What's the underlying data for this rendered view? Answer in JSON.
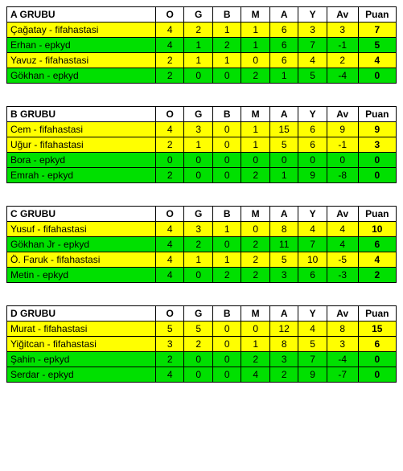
{
  "headers": {
    "o": "O",
    "g": "G",
    "b": "B",
    "m": "M",
    "a": "A",
    "y": "Y",
    "av": "Av",
    "puan": "Puan"
  },
  "groups": [
    {
      "title": "A GRUBU",
      "rows": [
        {
          "name": "Çağatay - fifahastasi",
          "cls": "yellow",
          "o": 4,
          "g": 2,
          "b": 1,
          "m": 1,
          "a": 6,
          "y": 3,
          "av": 3,
          "pts": 7
        },
        {
          "name": "Erhan - epkyd",
          "cls": "green",
          "o": 4,
          "g": 1,
          "b": 2,
          "m": 1,
          "a": 6,
          "y": 7,
          "av": -1,
          "pts": 5
        },
        {
          "name": "Yavuz - fifahastasi",
          "cls": "yellow",
          "o": 2,
          "g": 1,
          "b": 1,
          "m": 0,
          "a": 6,
          "y": 4,
          "av": 2,
          "pts": 4
        },
        {
          "name": "Gökhan - epkyd",
          "cls": "green",
          "o": 2,
          "g": 0,
          "b": 0,
          "m": 2,
          "a": 1,
          "y": 5,
          "av": -4,
          "pts": 0
        }
      ]
    },
    {
      "title": "B GRUBU",
      "rows": [
        {
          "name": "Cem - fifahastasi",
          "cls": "yellow",
          "o": 4,
          "g": 3,
          "b": 0,
          "m": 1,
          "a": 15,
          "y": 6,
          "av": 9,
          "pts": 9
        },
        {
          "name": "Uğur - fifahastasi",
          "cls": "yellow",
          "o": 2,
          "g": 1,
          "b": 0,
          "m": 1,
          "a": 5,
          "y": 6,
          "av": -1,
          "pts": 3
        },
        {
          "name": "Bora - epkyd",
          "cls": "green",
          "o": 0,
          "g": 0,
          "b": 0,
          "m": 0,
          "a": 0,
          "y": 0,
          "av": 0,
          "pts": 0
        },
        {
          "name": "Emrah - epkyd",
          "cls": "green",
          "o": 2,
          "g": 0,
          "b": 0,
          "m": 2,
          "a": 1,
          "y": 9,
          "av": -8,
          "pts": 0
        }
      ]
    },
    {
      "title": "C GRUBU",
      "rows": [
        {
          "name": "Yusuf - fifahastasi",
          "cls": "yellow",
          "o": 4,
          "g": 3,
          "b": 1,
          "m": 0,
          "a": 8,
          "y": 4,
          "av": 4,
          "pts": 10
        },
        {
          "name": "Gökhan Jr - epkyd",
          "cls": "green",
          "o": 4,
          "g": 2,
          "b": 0,
          "m": 2,
          "a": 11,
          "y": 7,
          "av": 4,
          "pts": 6
        },
        {
          "name": "Ö. Faruk - fifahastasi",
          "cls": "yellow",
          "o": 4,
          "g": 1,
          "b": 1,
          "m": 2,
          "a": 5,
          "y": 10,
          "av": -5,
          "pts": 4
        },
        {
          "name": "Metin - epkyd",
          "cls": "green",
          "o": 4,
          "g": 0,
          "b": 2,
          "m": 2,
          "a": 3,
          "y": 6,
          "av": -3,
          "pts": 2
        }
      ]
    },
    {
      "title": "D GRUBU",
      "rows": [
        {
          "name": "Murat - fifahastasi",
          "cls": "yellow",
          "o": 5,
          "g": 5,
          "b": 0,
          "m": 0,
          "a": 12,
          "y": 4,
          "av": 8,
          "pts": 15
        },
        {
          "name": "Yiğitcan - fifahastasi",
          "cls": "yellow",
          "o": 3,
          "g": 2,
          "b": 0,
          "m": 1,
          "a": 8,
          "y": 5,
          "av": 3,
          "pts": 6
        },
        {
          "name": "Şahin - epkyd",
          "cls": "green",
          "o": 2,
          "g": 0,
          "b": 0,
          "m": 2,
          "a": 3,
          "y": 7,
          "av": -4,
          "pts": 0
        },
        {
          "name": "Serdar - epkyd",
          "cls": "green",
          "o": 4,
          "g": 0,
          "b": 0,
          "m": 4,
          "a": 2,
          "y": 9,
          "av": -7,
          "pts": 0
        }
      ]
    }
  ]
}
